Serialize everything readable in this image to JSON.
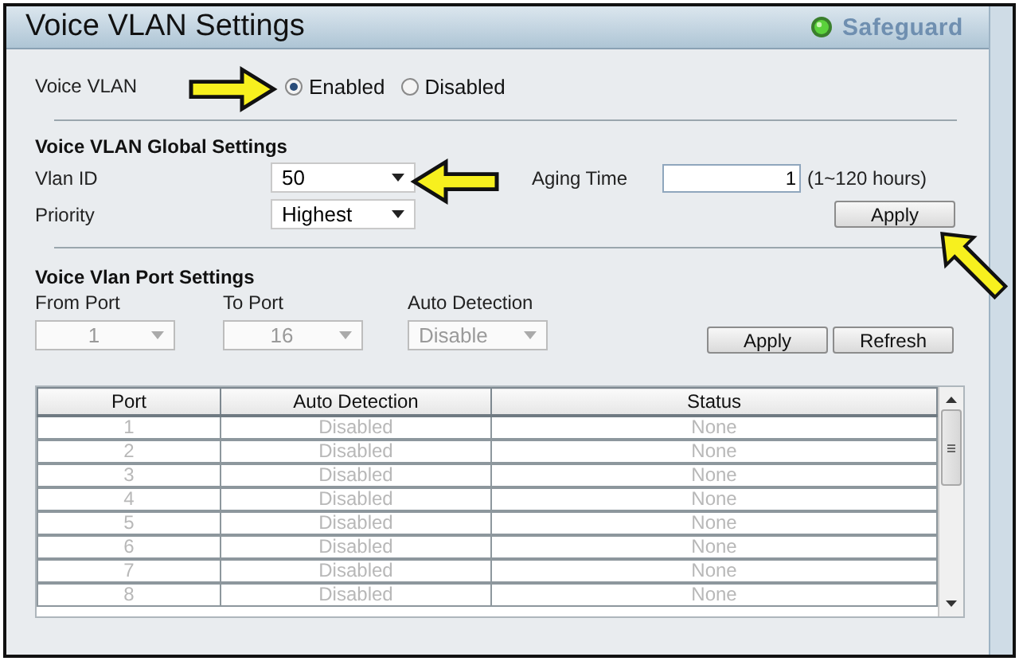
{
  "window": {
    "title": "Voice VLAN Settings",
    "badge": "Safeguard"
  },
  "voice_vlan": {
    "label": "Voice VLAN",
    "options": [
      {
        "label": "Enabled",
        "selected": true
      },
      {
        "label": "Disabled",
        "selected": false
      }
    ]
  },
  "global_settings": {
    "title": "Voice VLAN Global Settings",
    "fields": [
      {
        "label": "Vlan ID",
        "value": "50",
        "disabled": false
      },
      {
        "label": "Priority",
        "value": "Highest",
        "disabled": false
      }
    ],
    "aging_time": {
      "label": "Aging Time",
      "value": "1",
      "hint": "(1~120 hours)"
    },
    "button": "Apply"
  },
  "port_settings": {
    "title": "Voice Vlan Port Settings",
    "fields": [
      {
        "label": "From Port",
        "value": "1",
        "disabled": true
      },
      {
        "label": "To Port",
        "value": "16",
        "disabled": true
      },
      {
        "label": "Auto Detection",
        "value": "Disable",
        "disabled": true
      }
    ],
    "buttons": [
      "Apply",
      "Refresh"
    ]
  },
  "table": {
    "columns": [
      "Port",
      "Auto Detection",
      "Status"
    ],
    "rows": [
      [
        "1",
        "Disabled",
        "None"
      ],
      [
        "2",
        "Disabled",
        "None"
      ],
      [
        "3",
        "Disabled",
        "None"
      ],
      [
        "4",
        "Disabled",
        "None"
      ],
      [
        "5",
        "Disabled",
        "None"
      ],
      [
        "6",
        "Disabled",
        "None"
      ],
      [
        "7",
        "Disabled",
        "None"
      ],
      [
        "8",
        "Disabled",
        "None"
      ]
    ]
  },
  "annotations": [
    {
      "kind": "arrow"
    },
    {
      "kind": "arrow"
    },
    {
      "kind": "arrow"
    }
  ]
}
